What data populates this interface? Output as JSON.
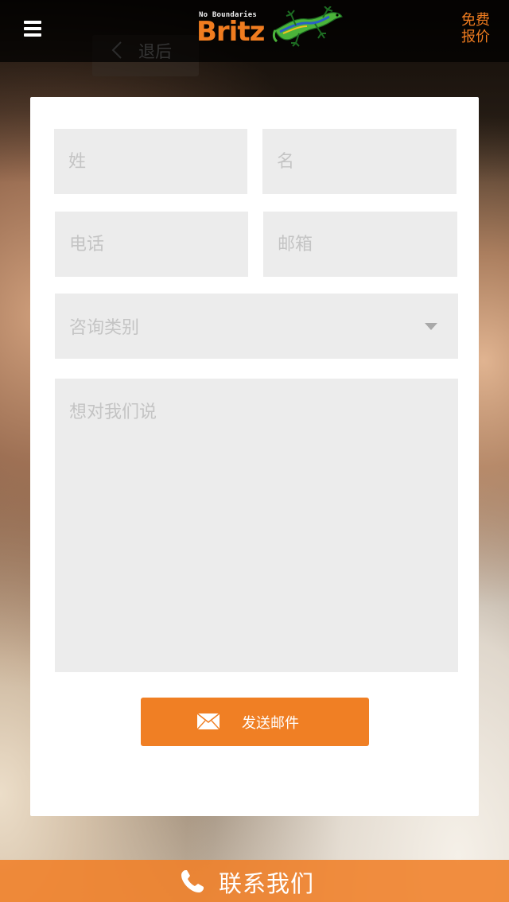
{
  "header": {
    "menu_icon": "hamburger-menu-icon",
    "logo": {
      "tagline": "No Boundaries",
      "wordmark": "Britz",
      "mascot_icon": "lizard-icon"
    },
    "quote_button": {
      "line1": "免费",
      "line2": "报价"
    },
    "accent_color": "#f07c1f"
  },
  "back_button": {
    "icon": "chevron-left-icon",
    "label": "退后"
  },
  "form": {
    "last_name": {
      "placeholder": "姓",
      "value": ""
    },
    "first_name": {
      "placeholder": "名",
      "value": ""
    },
    "phone": {
      "placeholder": "电话",
      "value": ""
    },
    "email": {
      "placeholder": "邮箱",
      "value": ""
    },
    "category": {
      "selected": "咨询类别",
      "icon": "dropdown-caret-icon"
    },
    "message": {
      "placeholder": "想对我们说",
      "value": ""
    },
    "submit": {
      "icon": "envelope-icon",
      "label": "发送邮件",
      "color": "#f07f24"
    }
  },
  "contact_bar": {
    "icon": "phone-icon",
    "label": "联系我们",
    "color": "#f08028"
  }
}
